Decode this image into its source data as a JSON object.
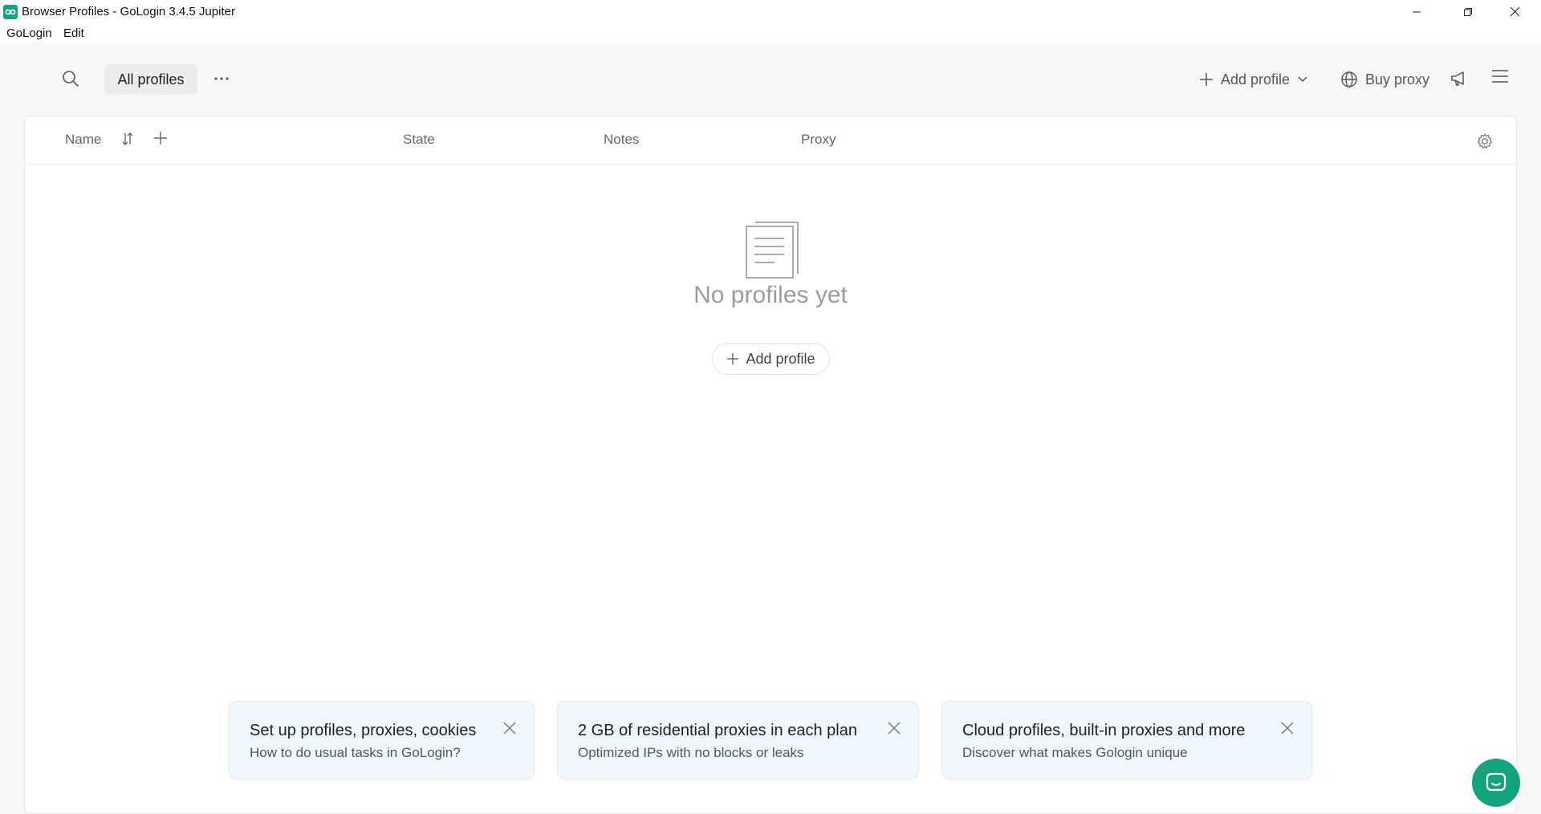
{
  "window": {
    "title": "Browser Profiles - GoLogin 3.4.5 Jupiter",
    "app_icon": "gologin-logo-icon",
    "controls": [
      "minimize-icon",
      "restore-icon",
      "close-icon"
    ]
  },
  "menubar": {
    "items": [
      {
        "label": "GoLogin"
      },
      {
        "label": "Edit"
      }
    ]
  },
  "toolbar": {
    "search_icon": "search-icon",
    "folder_label": "All profiles",
    "more_icon": "more-horizontal-icon",
    "add_profile_label": "Add profile",
    "buy_proxy_label": "Buy proxy",
    "announcements_icon": "megaphone-icon",
    "menu_icon": "hamburger-menu-icon"
  },
  "table": {
    "columns": [
      {
        "label": "Name"
      },
      {
        "label": "State"
      },
      {
        "label": "Notes"
      },
      {
        "label": "Proxy"
      }
    ],
    "sort_icon": "sort-icon",
    "add_column_icon": "plus-icon",
    "settings_icon": "gear-icon"
  },
  "empty_state": {
    "icon": "document-icon",
    "title": "No profiles yet",
    "button_label": "Add profile"
  },
  "promo_cards": [
    {
      "title": "Set up profiles, proxies, cookies",
      "subtitle": "How to do usual tasks in GoLogin?"
    },
    {
      "title": "2 GB of residential proxies in each plan",
      "subtitle": "Optimized IPs with no blocks or leaks"
    },
    {
      "title": "Cloud profiles, built-in proxies and more",
      "subtitle": "Discover what makes Gologin unique"
    }
  ],
  "chat_widget": {
    "icon": "chat-icon"
  },
  "colors": {
    "brand": "#14a37f",
    "background": "#f7f7f7",
    "card_background": "#eef8fd"
  }
}
